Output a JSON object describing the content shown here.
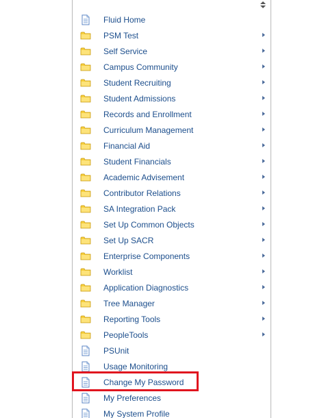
{
  "menu": {
    "items": [
      {
        "label": "Fluid Home",
        "icon": "page-icon",
        "submenu": false
      },
      {
        "label": "PSM Test",
        "icon": "folder-icon",
        "submenu": true
      },
      {
        "label": "Self Service",
        "icon": "folder-icon",
        "submenu": true
      },
      {
        "label": "Campus Community",
        "icon": "folder-icon",
        "submenu": true
      },
      {
        "label": "Student Recruiting",
        "icon": "folder-icon",
        "submenu": true
      },
      {
        "label": "Student Admissions",
        "icon": "folder-icon",
        "submenu": true
      },
      {
        "label": "Records and Enrollment",
        "icon": "folder-icon",
        "submenu": true
      },
      {
        "label": "Curriculum Management",
        "icon": "folder-icon",
        "submenu": true
      },
      {
        "label": "Financial Aid",
        "icon": "folder-icon",
        "submenu": true
      },
      {
        "label": "Student Financials",
        "icon": "folder-icon",
        "submenu": true
      },
      {
        "label": "Academic Advisement",
        "icon": "folder-icon",
        "submenu": true
      },
      {
        "label": "Contributor Relations",
        "icon": "folder-icon",
        "submenu": true
      },
      {
        "label": "SA Integration Pack",
        "icon": "folder-icon",
        "submenu": true
      },
      {
        "label": "Set Up Common Objects",
        "icon": "folder-icon",
        "submenu": true
      },
      {
        "label": "Set Up SACR",
        "icon": "folder-icon",
        "submenu": true
      },
      {
        "label": "Enterprise Components",
        "icon": "folder-icon",
        "submenu": true
      },
      {
        "label": "Worklist",
        "icon": "folder-icon",
        "submenu": true
      },
      {
        "label": "Application Diagnostics",
        "icon": "folder-icon",
        "submenu": true
      },
      {
        "label": "Tree Manager",
        "icon": "folder-icon",
        "submenu": true
      },
      {
        "label": "Reporting Tools",
        "icon": "folder-icon",
        "submenu": true
      },
      {
        "label": "PeopleTools",
        "icon": "folder-icon",
        "submenu": true
      },
      {
        "label": "PSUnit",
        "icon": "page-icon",
        "submenu": false
      },
      {
        "label": "Usage Monitoring",
        "icon": "page-icon",
        "submenu": false
      },
      {
        "label": "Change My Password",
        "icon": "page-icon",
        "submenu": false
      },
      {
        "label": "My Preferences",
        "icon": "page-icon",
        "submenu": false
      },
      {
        "label": "My System Profile",
        "icon": "page-icon",
        "submenu": false
      }
    ],
    "highlighted_item": "Change My Password"
  },
  "colors": {
    "link": "#1c4e8c",
    "highlight_border": "#e0141e",
    "folder": "#f5c518",
    "page_icon": "#4a7bbf"
  }
}
